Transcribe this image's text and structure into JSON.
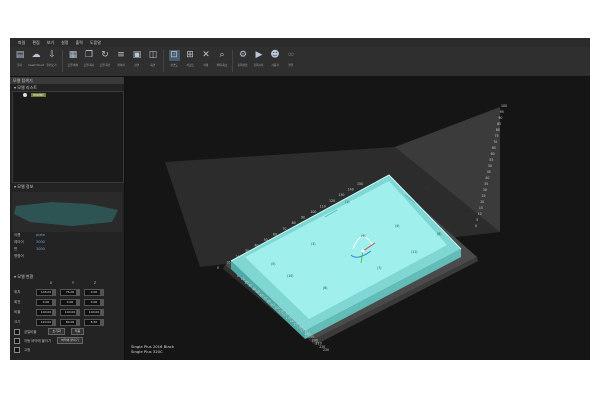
{
  "menu": [
    "파일",
    "편집",
    "보기",
    "설정",
    "출력",
    "도움말"
  ],
  "toolbar": [
    {
      "label": "열기",
      "icon": "folder-icon"
    },
    {
      "label": "Insert Cloud",
      "icon": "cloud-insert-icon"
    },
    {
      "label": "불러오기",
      "icon": "import-icon"
    },
    {
      "label": "모델 배치",
      "icon": "model-layout-icon"
    },
    {
      "label": "모델 복사",
      "icon": "model-copy-icon"
    },
    {
      "label": "모델 회전",
      "icon": "model-rotate-icon"
    },
    {
      "label": "레이어",
      "icon": "layer-icon"
    },
    {
      "label": "정면",
      "icon": "front-view-icon"
    },
    {
      "label": "측면",
      "icon": "side-view-icon"
    },
    {
      "label": "상면도",
      "icon": "top-view-icon"
    },
    {
      "label": "서포트",
      "icon": "support-icon"
    },
    {
      "label": "삭제",
      "icon": "delete-icon"
    },
    {
      "label": "확대·축소",
      "icon": "zoom-icon"
    },
    {
      "label": "출력설정",
      "icon": "print-settings-icon"
    },
    {
      "label": "출력시작",
      "icon": "print-start-icon"
    },
    {
      "label": "사용자",
      "icon": "user-icon"
    },
    {
      "label": "연결",
      "icon": "link-icon"
    }
  ],
  "left_panel": {
    "title": "모델 탐색기",
    "tree_section": "모델 리스트",
    "tree_items": [
      {
        "name": "model"
      }
    ],
    "info_section": "모델 정보",
    "info": [
      {
        "k": "이름",
        "v": "plate"
      },
      {
        "k": "레이어",
        "v": "3000"
      },
      {
        "k": "면",
        "v": "3000"
      },
      {
        "k": "명령어",
        "v": ""
      }
    ],
    "transform_section": "모델 변환",
    "axes": [
      "X",
      "Y",
      "Z"
    ],
    "rows": [
      {
        "label": "위치",
        "values": [
          "106.00",
          "76.00",
          "0.00"
        ]
      },
      {
        "label": "회전",
        "values": [
          "0.00",
          "0.00",
          "0.00"
        ]
      },
      {
        "label": "비율",
        "values": [
          "100.00",
          "100.00",
          "100.00"
        ]
      },
      {
        "label": "크기",
        "values": [
          "120.00",
          "80.00",
          "6.50"
        ]
      }
    ],
    "checks": [
      {
        "label": "균일비율",
        "button": "초기화",
        "button2": "적용"
      },
      {
        "label": "자동 바닥에 붙이기",
        "button": "바닥에 붙이기"
      },
      {
        "label": "고정"
      }
    ]
  },
  "viewport": {
    "overlay": [
      "Single Plus 2016 Black",
      "Single Plus 320C"
    ],
    "colors": {
      "model": "#8fe3e0",
      "model_edge": "#5bb7b4",
      "plate": "#6b6b6b",
      "bg": "#151515"
    },
    "left_ticks": [
      "0",
      "10",
      "20",
      "30",
      "40",
      "50",
      "60",
      "70",
      "80",
      "90",
      "100",
      "110",
      "120",
      "130",
      "140",
      "150"
    ],
    "bottom_ticks": [
      "0",
      "10",
      "20",
      "30",
      "40",
      "50",
      "60",
      "70",
      "80",
      "90",
      "100",
      "110",
      "120",
      "130",
      "140",
      "150",
      "160",
      "170",
      "180",
      "190",
      "200",
      "210",
      "220",
      "230"
    ],
    "z_ticks": [
      "0",
      "5",
      "10",
      "15",
      "20",
      "25",
      "30",
      "35",
      "40",
      "45",
      "50",
      "55",
      "60",
      "65",
      "70",
      "75",
      "80",
      "85",
      "90",
      "95",
      "100"
    ],
    "markers": [
      "(1)",
      "(2)",
      "(3)",
      "(4)",
      "(5)",
      "(6)",
      "(7)",
      "(8)",
      "(9)",
      "(10)",
      "(11)"
    ]
  }
}
